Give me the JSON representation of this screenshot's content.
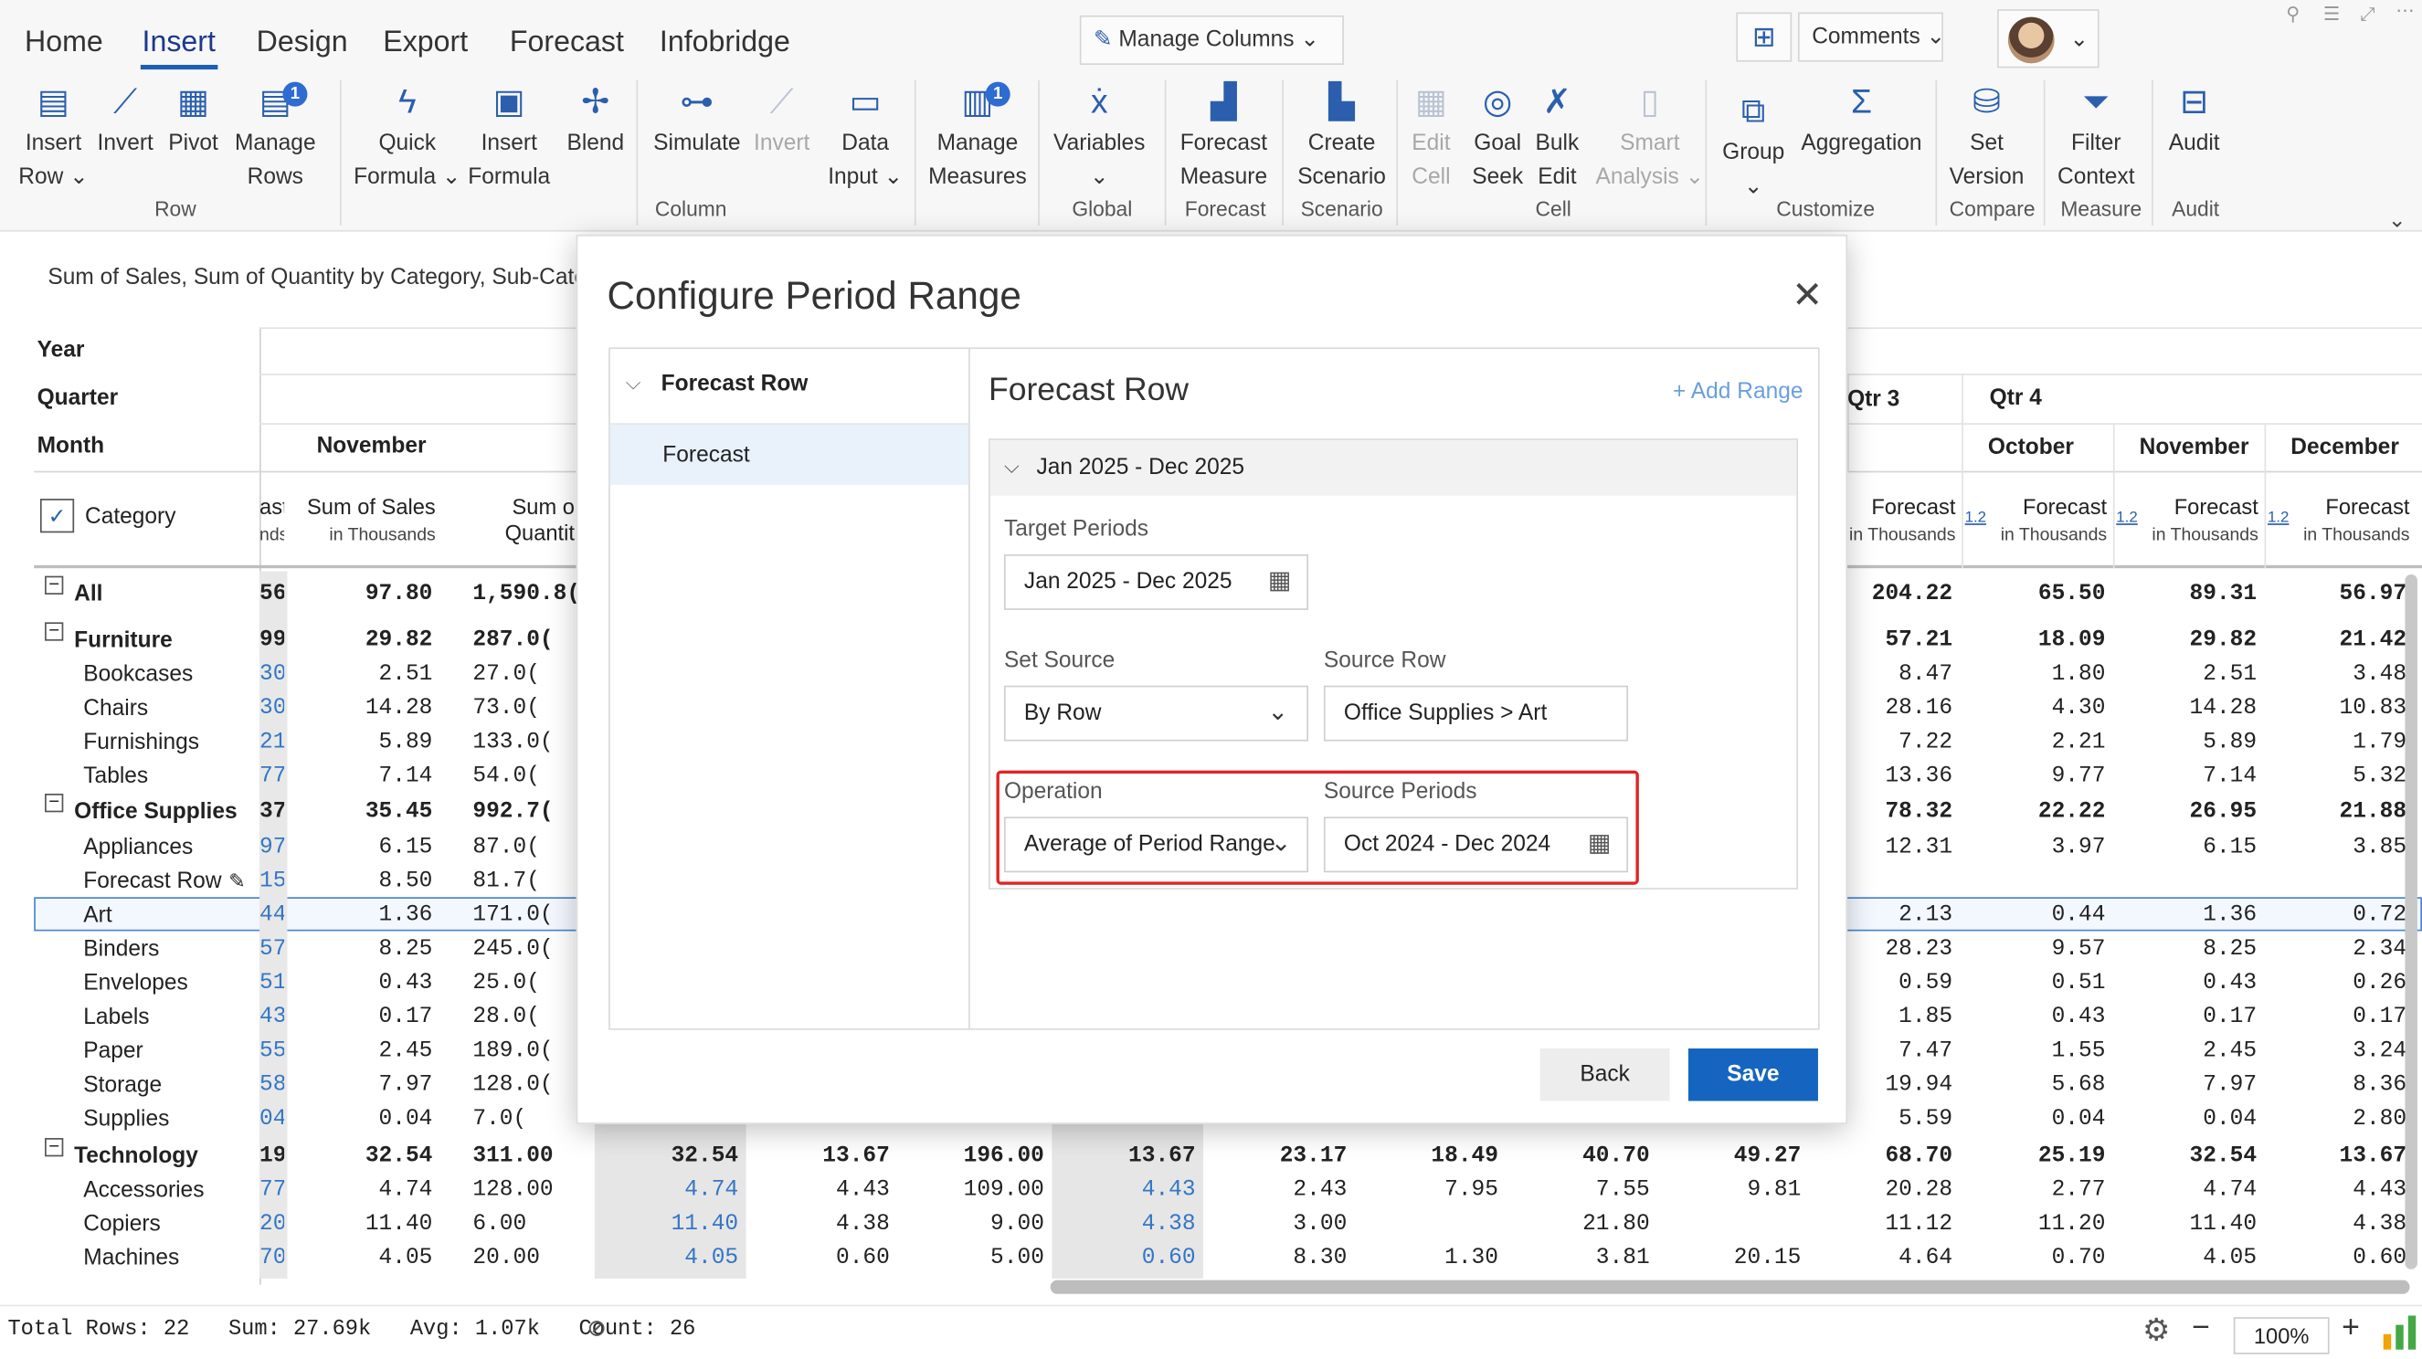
{
  "ribbon": {
    "tabs": [
      "Home",
      "Insert",
      "Design",
      "Export",
      "Forecast",
      "Infobridge"
    ],
    "manage_columns": "Manage Columns",
    "comments": "Comments",
    "commands": {
      "insert_row": [
        "Insert",
        "Row"
      ],
      "invert": "Invert",
      "pivot": "Pivot",
      "manage_rows": [
        "Manage",
        "Rows"
      ],
      "quick_formula": [
        "Quick",
        "Formula"
      ],
      "insert_formula": [
        "Insert",
        "Formula"
      ],
      "blend": "Blend",
      "simulate": "Simulate",
      "invert2": "Invert",
      "data_input": [
        "Data",
        "Input"
      ],
      "manage_measures": [
        "Manage",
        "Measures"
      ],
      "variables": "Variables",
      "forecast_measure": [
        "Forecast",
        "Measure"
      ],
      "create_scenario": [
        "Create",
        "Scenario"
      ],
      "edit_cell": [
        "Edit",
        "Cell"
      ],
      "goal_seek": [
        "Goal",
        "Seek"
      ],
      "bulk_edit": [
        "Bulk",
        "Edit"
      ],
      "smart_analysis": [
        "Smart",
        "Analysis"
      ],
      "group": "Group",
      "aggregation": "Aggregation",
      "set_version": [
        "Set",
        "Version"
      ],
      "filter_context": [
        "Filter",
        "Context"
      ],
      "audit": "Audit"
    },
    "badges": {
      "manage_rows": "1",
      "manage_measures": "1"
    },
    "groups": {
      "row": "Row",
      "column": "Column",
      "global": "Global",
      "forecast": "Forecast",
      "scenario": "Scenario",
      "cell": "Cell",
      "customize": "Customize",
      "compare": "Compare",
      "measure": "Measure",
      "audit": "Audit"
    }
  },
  "report": {
    "subtitle": "Sum of Sales, Sum of Quantity by Category, Sub-Cate",
    "row_labels": {
      "year": "Year",
      "quarter": "Quarter",
      "month": "Month",
      "category": "Category"
    },
    "left_headers": {
      "partial_top": "ast",
      "partial_bottom": "nds",
      "november": "November",
      "sales": "Sum of Sales",
      "sales_sub": "in Thousands",
      "qty": "Sum o",
      "qty_sub": "Quantit"
    },
    "right_headers": {
      "qtr3": "Qtr 3",
      "qtr4": "Qtr 4",
      "months": [
        "October",
        "November",
        "December"
      ],
      "forecast": "Forecast",
      "forecast_sub": "in Thousands",
      "sort_icon": "1.2"
    },
    "rows": [
      {
        "label": "All",
        "level": 0,
        "bold": true,
        "partial": "56",
        "sales": "97.80",
        "qty": "1,590.8(",
        "q3": "204.22",
        "oct": "65.50",
        "nov": "89.31",
        "dec": "56.97"
      },
      {
        "label": "Furniture",
        "level": 0,
        "bold": true,
        "partial": "99",
        "sales": "29.82",
        "qty": "287.0(",
        "q3": "57.21",
        "oct": "18.09",
        "nov": "29.82",
        "dec": "21.42"
      },
      {
        "label": "Bookcases",
        "level": 1,
        "partial": "30",
        "sales": "2.51",
        "qty": "27.0(",
        "q3": "8.47",
        "oct": "1.80",
        "nov": "2.51",
        "dec": "3.48"
      },
      {
        "label": "Chairs",
        "level": 1,
        "partial": "30",
        "sales": "14.28",
        "qty": "73.0(",
        "q3": "28.16",
        "oct": "4.30",
        "nov": "14.28",
        "dec": "10.83"
      },
      {
        "label": "Furnishings",
        "level": 1,
        "partial": "21",
        "sales": "5.89",
        "qty": "133.0(",
        "q3": "7.22",
        "oct": "2.21",
        "nov": "5.89",
        "dec": "1.79"
      },
      {
        "label": "Tables",
        "level": 1,
        "partial": "77",
        "sales": "7.14",
        "qty": "54.0(",
        "q3": "13.36",
        "oct": "9.77",
        "nov": "7.14",
        "dec": "5.32"
      },
      {
        "label": "Office Supplies",
        "level": 0,
        "bold": true,
        "partial": "37",
        "sales": "35.45",
        "qty": "992.7(",
        "q3": "78.32",
        "oct": "22.22",
        "nov": "26.95",
        "dec": "21.88"
      },
      {
        "label": "Appliances",
        "level": 1,
        "partial": "97",
        "sales": "6.15",
        "qty": "87.0(",
        "q3": "12.31",
        "oct": "3.97",
        "nov": "6.15",
        "dec": "3.85"
      },
      {
        "label": "Forecast Row",
        "level": 1,
        "partial": "15",
        "sales": "8.50",
        "qty": "81.7(",
        "q3": "",
        "oct": "",
        "nov": "",
        "dec": ""
      },
      {
        "label": "Art",
        "level": 1,
        "partial": "44",
        "sales": "1.36",
        "qty": "171.0(",
        "q3": "2.13",
        "oct": "0.44",
        "nov": "1.36",
        "dec": "0.72"
      },
      {
        "label": "Binders",
        "level": 1,
        "partial": "57",
        "sales": "8.25",
        "qty": "245.0(",
        "q3": "28.23",
        "oct": "9.57",
        "nov": "8.25",
        "dec": "2.34"
      },
      {
        "label": "Envelopes",
        "level": 1,
        "partial": "51",
        "sales": "0.43",
        "qty": "25.0(",
        "q3": "0.59",
        "oct": "0.51",
        "nov": "0.43",
        "dec": "0.26"
      },
      {
        "label": "Labels",
        "level": 1,
        "partial": "43",
        "sales": "0.17",
        "qty": "28.0(",
        "q3": "1.85",
        "oct": "0.43",
        "nov": "0.17",
        "dec": "0.17"
      },
      {
        "label": "Paper",
        "level": 1,
        "partial": "55",
        "sales": "2.45",
        "qty": "189.0(",
        "q3": "7.47",
        "oct": "1.55",
        "nov": "2.45",
        "dec": "3.24"
      },
      {
        "label": "Storage",
        "level": 1,
        "partial": "58",
        "sales": "7.97",
        "qty": "128.0(",
        "q3": "19.94",
        "oct": "5.68",
        "nov": "7.97",
        "dec": "8.36"
      },
      {
        "label": "Supplies",
        "level": 1,
        "partial": "04",
        "sales": "0.04",
        "qty": "7.0(",
        "q3": "5.59",
        "oct": "0.04",
        "nov": "0.04",
        "dec": "2.80"
      },
      {
        "label": "Technology",
        "level": 0,
        "bold": true,
        "partial": "19",
        "sales": "32.54",
        "qty": "311.00",
        "q3": "68.70",
        "oct": "25.19",
        "nov": "32.54",
        "dec": "13.67"
      },
      {
        "label": "Accessories",
        "level": 1,
        "partial": "77",
        "sales": "4.74",
        "qty": "128.00",
        "q3": "20.28",
        "oct": "2.77",
        "nov": "4.74",
        "dec": "4.43"
      },
      {
        "label": "Copiers",
        "level": 1,
        "partial": "20",
        "sales": "11.40",
        "qty": "6.00",
        "q3": "11.12",
        "oct": "11.20",
        "nov": "11.40",
        "dec": "4.38"
      },
      {
        "label": "Machines",
        "level": 1,
        "partial": "70",
        "sales": "4.05",
        "qty": "20.00",
        "q3": "4.64",
        "oct": "0.70",
        "nov": "4.05",
        "dec": "0.60"
      }
    ],
    "hidden_rows": [
      [
        "32.54",
        "13.67",
        "196.00",
        "13.67",
        "23.17",
        "18.49",
        "40.70",
        "49.27"
      ],
      [
        "4.74",
        "4.43",
        "109.00",
        "4.43",
        "2.43",
        "7.95",
        "7.55",
        "9.81"
      ],
      [
        "11.40",
        "4.38",
        "9.00",
        "4.38",
        "3.00",
        "",
        "21.80",
        ""
      ],
      [
        "4.05",
        "0.60",
        "5.00",
        "0.60",
        "8.30",
        "1.30",
        "3.81",
        "20.15"
      ]
    ]
  },
  "modal": {
    "title": "Configure Period Range",
    "side_header": "Forecast Row",
    "side_item": "Forecast",
    "main_title": "Forecast Row",
    "add_range": "+ Add Range",
    "section": "Jan 2025 - Dec 2025",
    "target_periods_label": "Target Periods",
    "target_periods_value": "Jan 2025 - Dec 2025",
    "set_source_label": "Set Source",
    "set_source_value": "By Row",
    "source_row_label": "Source Row",
    "source_row_value": "Office Supplies > Art",
    "operation_label": "Operation",
    "operation_value": "Average of Period Range",
    "source_periods_label": "Source Periods",
    "source_periods_value": "Oct 2024 - Dec 2024",
    "back": "Back",
    "save": "Save"
  },
  "status": {
    "total_rows": "Total Rows: 22",
    "sum": "Sum: 27.69k",
    "avg": "Avg: 1.07k",
    "count": "Count: 26",
    "zoom": "100%"
  },
  "colors": {
    "accent": "#1b5fb4",
    "save": "#1565c0",
    "highlight": "#e02424",
    "link_blue": "#3476c5"
  }
}
